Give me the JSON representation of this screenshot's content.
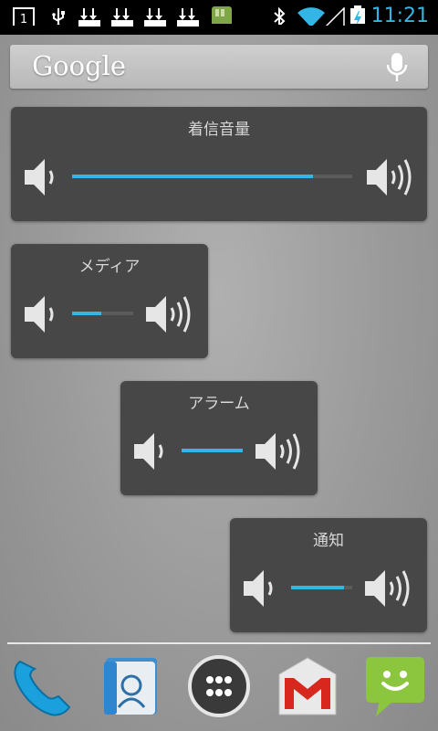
{
  "status_bar": {
    "time": "11:21",
    "notification_count": "1",
    "accent_color": "#33b5e5",
    "icons": [
      "notification-count-icon",
      "usb-icon",
      "download-icon",
      "download-icon",
      "download-icon",
      "download-icon",
      "sd-card-icon",
      "bluetooth-icon",
      "wifi-icon",
      "signal-icon",
      "battery-charging-icon"
    ]
  },
  "search": {
    "logo": "Google",
    "voice_icon": "mic-icon"
  },
  "volume_widgets": [
    {
      "label": "着信音量",
      "level": 0.86
    },
    {
      "label": "メディア",
      "level": 0.48
    },
    {
      "label": "アラーム",
      "level": 1.0
    },
    {
      "label": "通知",
      "level": 0.86
    }
  ],
  "dock": {
    "items": [
      "phone-icon",
      "contacts-icon",
      "app-drawer-icon",
      "gmail-icon",
      "messaging-icon"
    ]
  }
}
